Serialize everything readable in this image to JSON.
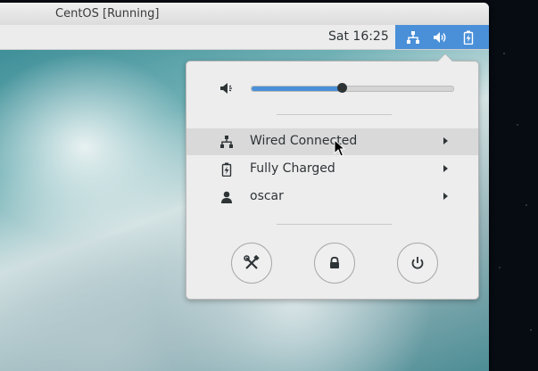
{
  "vm_window": {
    "title": "CentOS [Running]"
  },
  "topbar": {
    "clock": "Sat 16:25",
    "status_icons": [
      "network-wired-icon",
      "volume-icon",
      "battery-icon"
    ],
    "accent_color": "#4a90d9"
  },
  "system_menu": {
    "volume": {
      "icon": "volume-muted-icon",
      "level_percent": 45
    },
    "items": [
      {
        "label": "Wired Connected",
        "icon": "network-wired-icon",
        "highlighted": true
      },
      {
        "label": "Fully Charged",
        "icon": "battery-charged-icon",
        "highlighted": false
      },
      {
        "label": "oscar",
        "icon": "user-icon",
        "highlighted": false
      }
    ],
    "actions": [
      "settings-icon",
      "lock-icon",
      "power-icon"
    ]
  }
}
